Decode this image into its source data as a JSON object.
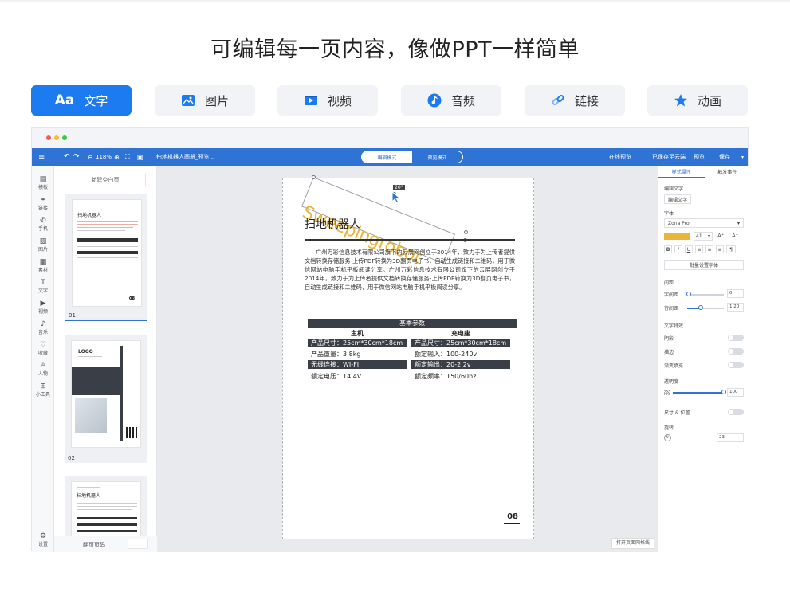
{
  "headline": "可编辑每一页内容，像做PPT一样简单",
  "feature_tabs": [
    {
      "icon": "Aa",
      "label": "文字",
      "active": true
    },
    {
      "icon": "image-icon",
      "label": "图片"
    },
    {
      "icon": "video-icon",
      "label": "视频"
    },
    {
      "icon": "music-icon",
      "label": "音频"
    },
    {
      "icon": "link-icon",
      "label": "链接"
    },
    {
      "icon": "star-icon",
      "label": "动画"
    }
  ],
  "app": {
    "toolbar": {
      "zoom": "118%",
      "doc_title": "扫地机器人画册_预览...",
      "mode_edit": "编辑模式",
      "mode_preview": "预览模式",
      "right_items": [
        "在线预览",
        "已保存至云端",
        "预览",
        "保存"
      ]
    },
    "leftbar": [
      "模板",
      "链接",
      "手机",
      "图片",
      "素材",
      "文字",
      "视频",
      "音乐",
      "收藏",
      "人物",
      "小工具"
    ],
    "leftbar_bottom": "设置",
    "thumbnails": {
      "add_page": "新建空白页",
      "pages": [
        {
          "num": "01",
          "title": "扫地机器人"
        },
        {
          "num": "02",
          "title": "LOGO"
        },
        {
          "num": "",
          "title": "扫地机器人"
        }
      ],
      "footer": "翻页页码"
    },
    "page": {
      "title": "扫地机器人",
      "wordart": "Sweepingrobot",
      "angle": "20°",
      "body": "广州万彩信息技术有限公司旗下的云展网创立于2014年，致力于为上传者提供文档转换存储服务-上传PDF转换为3D翻页电子书，自动生成链接和二维码，用于微信网站电脑手机平板阅读分享。广州万彩信息技术有限公司旗下的云展网创立于2014年，致力于为上传者提供文档转换存储服务-上传PDF转换为3D翻页电子书，自动生成链接和二维码，用于微信网站电脑手机平板阅读分享。",
      "table": {
        "header": "基本参数",
        "col_heads": [
          "主机",
          "充电座"
        ],
        "rows": [
          [
            "产品尺寸：25cm*30cm*18cm",
            "产品尺寸：25cm*30cm*18cm"
          ],
          [
            "产品重量：3.8kg",
            "额定输入：100-240v"
          ],
          [
            "无线连接：WI-FI",
            "额定输出：20-2.2v"
          ],
          [
            "额定电压：14.4V",
            "额定频率：150/60hz"
          ]
        ]
      },
      "page_number": "08",
      "canvas_footer": "打开页面网格线"
    },
    "rightpanel": {
      "tabs": [
        "样式属性",
        "触发事件"
      ],
      "section_text": "编辑文字",
      "text_button": "编辑文字",
      "font_label": "字体",
      "font_value": "Zona Pro",
      "font_size": "41",
      "accent_color": "#e9b63b",
      "apply_all": "批量设置字体",
      "spacing_label": "间距",
      "letter_spacing_label": "字间距",
      "letter_spacing_value": "0",
      "line_height_label": "行间距",
      "line_height_value": "1.20",
      "effects_label": "文字特效",
      "effects": [
        "阴影",
        "描边",
        "渐变填充"
      ],
      "opacity_label": "透明度",
      "opacity_value": "100",
      "size_position_label": "尺寸 & 位置",
      "rotate_label": "旋转",
      "rotate_value": "23"
    }
  }
}
